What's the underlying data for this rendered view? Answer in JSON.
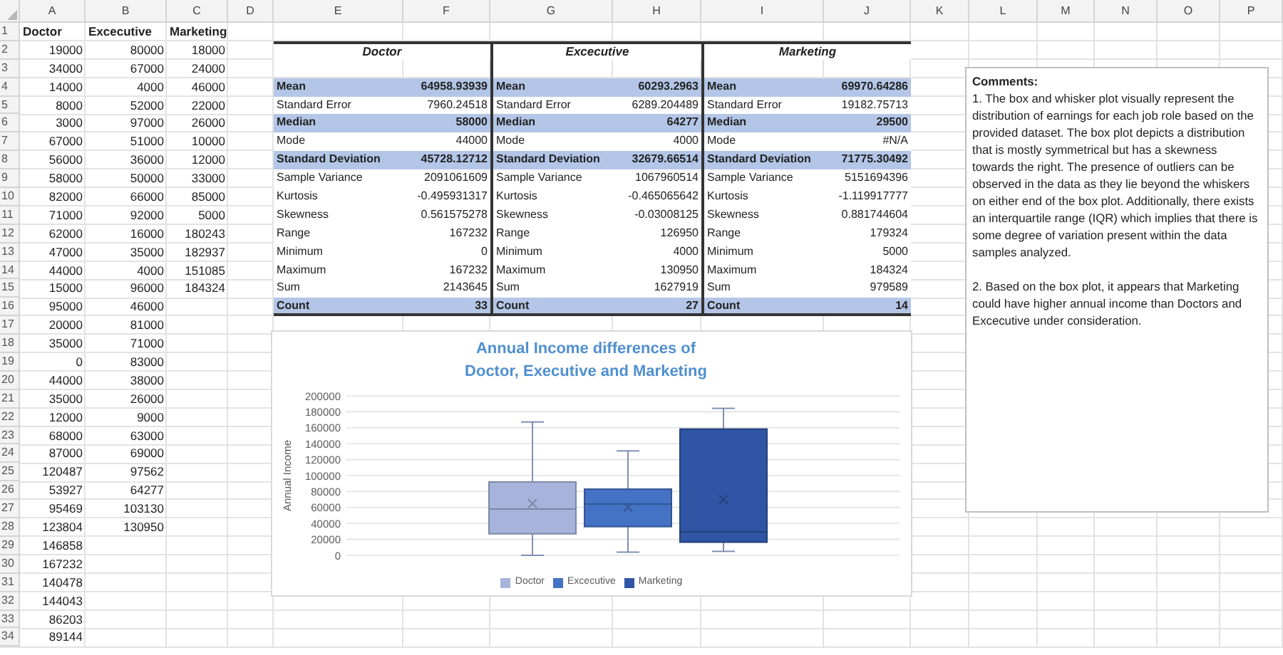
{
  "column_headers": [
    "A",
    "B",
    "C",
    "D",
    "E",
    "F",
    "G",
    "H",
    "I",
    "J",
    "K",
    "L",
    "M",
    "N",
    "O",
    "P"
  ],
  "row_numbers": [
    "1",
    "2",
    "3",
    "4",
    "5",
    "6",
    "7",
    "8",
    "9",
    "10",
    "11",
    "12",
    "13",
    "14",
    "15",
    "16",
    "17",
    "18",
    "19",
    "20",
    "21",
    "22",
    "23",
    "24",
    "25",
    "26",
    "27",
    "28",
    "29",
    "30",
    "31",
    "32",
    "33",
    "34"
  ],
  "data_columns": [
    {
      "header": "Doctor",
      "cells": [
        "19000",
        "34000",
        "14000",
        "8000",
        "3000",
        "67000",
        "56000",
        "58000",
        "82000",
        "71000",
        "62000",
        "47000",
        "44000",
        "15000",
        "95000",
        "20000",
        "35000",
        "0",
        "44000",
        "35000",
        "12000",
        "68000",
        "87000",
        "120487",
        "53927",
        "95469",
        "123804",
        "146858",
        "167232",
        "140478",
        "144043",
        "86203",
        "89144"
      ]
    },
    {
      "header": "Excecutive",
      "cells": [
        "80000",
        "67000",
        "4000",
        "52000",
        "97000",
        "51000",
        "36000",
        "50000",
        "66000",
        "92000",
        "16000",
        "35000",
        "4000",
        "96000",
        "46000",
        "81000",
        "71000",
        "83000",
        "38000",
        "26000",
        "9000",
        "63000",
        "69000",
        "97562",
        "64277",
        "103130",
        "130950"
      ]
    },
    {
      "header": "Marketing",
      "cells": [
        "18000",
        "24000",
        "46000",
        "22000",
        "26000",
        "10000",
        "12000",
        "33000",
        "85000",
        "5000",
        "180243",
        "182937",
        "151085",
        "184324"
      ]
    }
  ],
  "stats": [
    {
      "title": "Doctor",
      "rows": [
        {
          "label": "Mean",
          "value": "64958.93939",
          "highlighted": true
        },
        {
          "label": "Standard Error",
          "value": "7960.24518",
          "highlighted": false
        },
        {
          "label": "Median",
          "value": "58000",
          "highlighted": true
        },
        {
          "label": "Mode",
          "value": "44000",
          "highlighted": false
        },
        {
          "label": "Standard Deviation",
          "value": "45728.12712",
          "highlighted": true
        },
        {
          "label": "Sample Variance",
          "value": "2091061609",
          "highlighted": false
        },
        {
          "label": "Kurtosis",
          "value": "-0.495931317",
          "highlighted": false
        },
        {
          "label": "Skewness",
          "value": "0.561575278",
          "highlighted": false
        },
        {
          "label": "Range",
          "value": "167232",
          "highlighted": false
        },
        {
          "label": "Minimum",
          "value": "0",
          "highlighted": false
        },
        {
          "label": "Maximum",
          "value": "167232",
          "highlighted": false
        },
        {
          "label": "Sum",
          "value": "2143645",
          "highlighted": false
        },
        {
          "label": "Count",
          "value": "33",
          "highlighted": true
        }
      ]
    },
    {
      "title": "Excecutive",
      "rows": [
        {
          "label": "Mean",
          "value": "60293.2963",
          "highlighted": true
        },
        {
          "label": "Standard Error",
          "value": "6289.204489",
          "highlighted": false
        },
        {
          "label": "Median",
          "value": "64277",
          "highlighted": true
        },
        {
          "label": "Mode",
          "value": "4000",
          "highlighted": false
        },
        {
          "label": "Standard Deviation",
          "value": "32679.66514",
          "highlighted": true
        },
        {
          "label": "Sample Variance",
          "value": "1067960514",
          "highlighted": false
        },
        {
          "label": "Kurtosis",
          "value": "-0.465065642",
          "highlighted": false
        },
        {
          "label": "Skewness",
          "value": "-0.03008125",
          "highlighted": false
        },
        {
          "label": "Range",
          "value": "126950",
          "highlighted": false
        },
        {
          "label": "Minimum",
          "value": "4000",
          "highlighted": false
        },
        {
          "label": "Maximum",
          "value": "130950",
          "highlighted": false
        },
        {
          "label": "Sum",
          "value": "1627919",
          "highlighted": false
        },
        {
          "label": "Count",
          "value": "27",
          "highlighted": true
        }
      ]
    },
    {
      "title": "Marketing",
      "rows": [
        {
          "label": "Mean",
          "value": "69970.64286",
          "highlighted": true
        },
        {
          "label": "Standard Error",
          "value": "19182.75713",
          "highlighted": false
        },
        {
          "label": "Median",
          "value": "29500",
          "highlighted": true
        },
        {
          "label": "Mode",
          "value": "#N/A",
          "highlighted": false
        },
        {
          "label": "Standard Deviation",
          "value": "71775.30492",
          "highlighted": true
        },
        {
          "label": "Sample Variance",
          "value": "5151694396",
          "highlighted": false
        },
        {
          "label": "Kurtosis",
          "value": "-1.119917777",
          "highlighted": false
        },
        {
          "label": "Skewness",
          "value": "0.881744604",
          "highlighted": false
        },
        {
          "label": "Range",
          "value": "179324",
          "highlighted": false
        },
        {
          "label": "Minimum",
          "value": "5000",
          "highlighted": false
        },
        {
          "label": "Maximum",
          "value": "184324",
          "highlighted": false
        },
        {
          "label": "Sum",
          "value": "979589",
          "highlighted": false
        },
        {
          "label": "Count",
          "value": "14",
          "highlighted": true
        }
      ]
    }
  ],
  "chart": {
    "title": "Annual Income differences of Doctor, Executive and Marketing",
    "ylabel": "Annual Income",
    "ytick_labels": [
      "200000",
      "180000",
      "160000",
      "140000",
      "120000",
      "100000",
      "80000",
      "60000",
      "40000",
      "20000",
      "0"
    ],
    "legend": [
      {
        "name": "Doctor",
        "color": "#a6b4dc"
      },
      {
        "name": "Excecutive",
        "color": "#4472c4"
      },
      {
        "name": "Marketing",
        "color": "#2f55a4"
      }
    ]
  },
  "comments": {
    "title": "Comments:",
    "paragraphs": [
      "1. The box and whisker plot visually represent the distribution of earnings for each job role based on the provided dataset. The box plot depicts a distribution that is mostly symmetrical but has a skewness towards the right. The presence of outliers can be observed in the data as they lie beyond the whiskers on either end of the box plot. Additionally, there exists an interquartile range (IQR) which implies that there is some degree of variation present within the data samples analyzed.",
      "2. Based on the box plot, it appears that Marketing could have higher annual income than Doctors and Excecutive under consideration."
    ]
  }
}
